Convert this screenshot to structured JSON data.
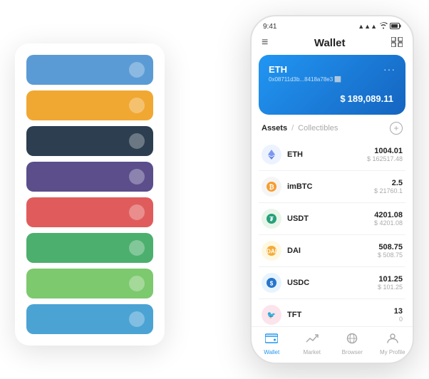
{
  "scene": {
    "card_stack": {
      "cards": [
        {
          "color": "card-blue"
        },
        {
          "color": "card-yellow"
        },
        {
          "color": "card-dark"
        },
        {
          "color": "card-purple"
        },
        {
          "color": "card-red"
        },
        {
          "color": "card-green"
        },
        {
          "color": "card-lightgreen"
        },
        {
          "color": "card-skyblue"
        }
      ]
    },
    "phone": {
      "status_bar": {
        "time": "9:41",
        "signal": "▲▲▲",
        "wifi": "wifi",
        "battery": "🔋"
      },
      "header": {
        "menu_icon": "≡",
        "title": "Wallet",
        "expand_icon": "⊡"
      },
      "eth_card": {
        "title": "ETH",
        "dots": "···",
        "address": "0x08711d3b...8418a78e3  ⬜",
        "balance_prefix": "$",
        "balance": "189,089.11"
      },
      "assets_section": {
        "tab_active": "Assets",
        "tab_divider": "/",
        "tab_inactive": "Collectibles",
        "add_icon": "+"
      },
      "assets": [
        {
          "name": "ETH",
          "icon": "⬨",
          "icon_class": "icon-eth",
          "amount": "1004.01",
          "usd": "$ 162517.48"
        },
        {
          "name": "imBTC",
          "icon": "⬤",
          "icon_class": "icon-imbtc",
          "amount": "2.5",
          "usd": "$ 21760.1"
        },
        {
          "name": "USDT",
          "icon": "₮",
          "icon_class": "icon-usdt",
          "amount": "4201.08",
          "usd": "$ 4201.08"
        },
        {
          "name": "DAI",
          "icon": "◈",
          "icon_class": "icon-dai",
          "amount": "508.75",
          "usd": "$ 508.75"
        },
        {
          "name": "USDC",
          "icon": "$",
          "icon_class": "icon-usdc",
          "amount": "101.25",
          "usd": "$ 101.25"
        },
        {
          "name": "TFT",
          "icon": "🐦",
          "icon_class": "icon-tft",
          "amount": "13",
          "usd": "0"
        }
      ],
      "bottom_nav": [
        {
          "label": "Wallet",
          "icon": "⊙",
          "active": true
        },
        {
          "label": "Market",
          "icon": "↗",
          "active": false
        },
        {
          "label": "Browser",
          "icon": "⊕",
          "active": false
        },
        {
          "label": "My Profile",
          "icon": "👤",
          "active": false
        }
      ]
    }
  }
}
